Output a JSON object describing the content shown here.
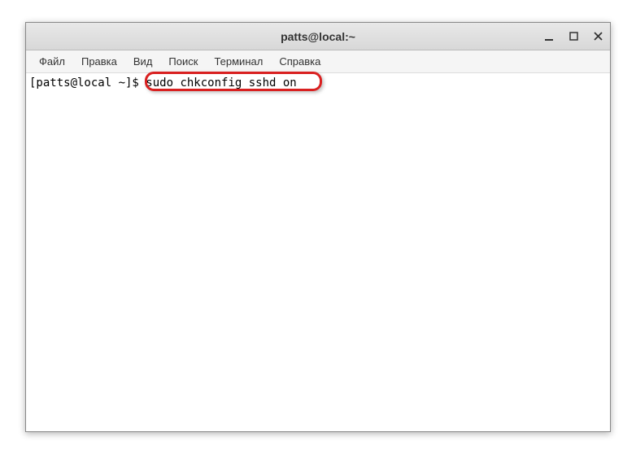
{
  "window": {
    "title": "patts@local:~"
  },
  "menubar": {
    "items": [
      {
        "label": "Файл"
      },
      {
        "label": "Правка"
      },
      {
        "label": "Вид"
      },
      {
        "label": "Поиск"
      },
      {
        "label": "Терминал"
      },
      {
        "label": "Справка"
      }
    ]
  },
  "terminal": {
    "prompt": "[patts@local ~]$ ",
    "command": "sudo chkconfig sshd on"
  },
  "window_controls": {
    "minimize": "_",
    "maximize": "□",
    "close": "✕"
  }
}
